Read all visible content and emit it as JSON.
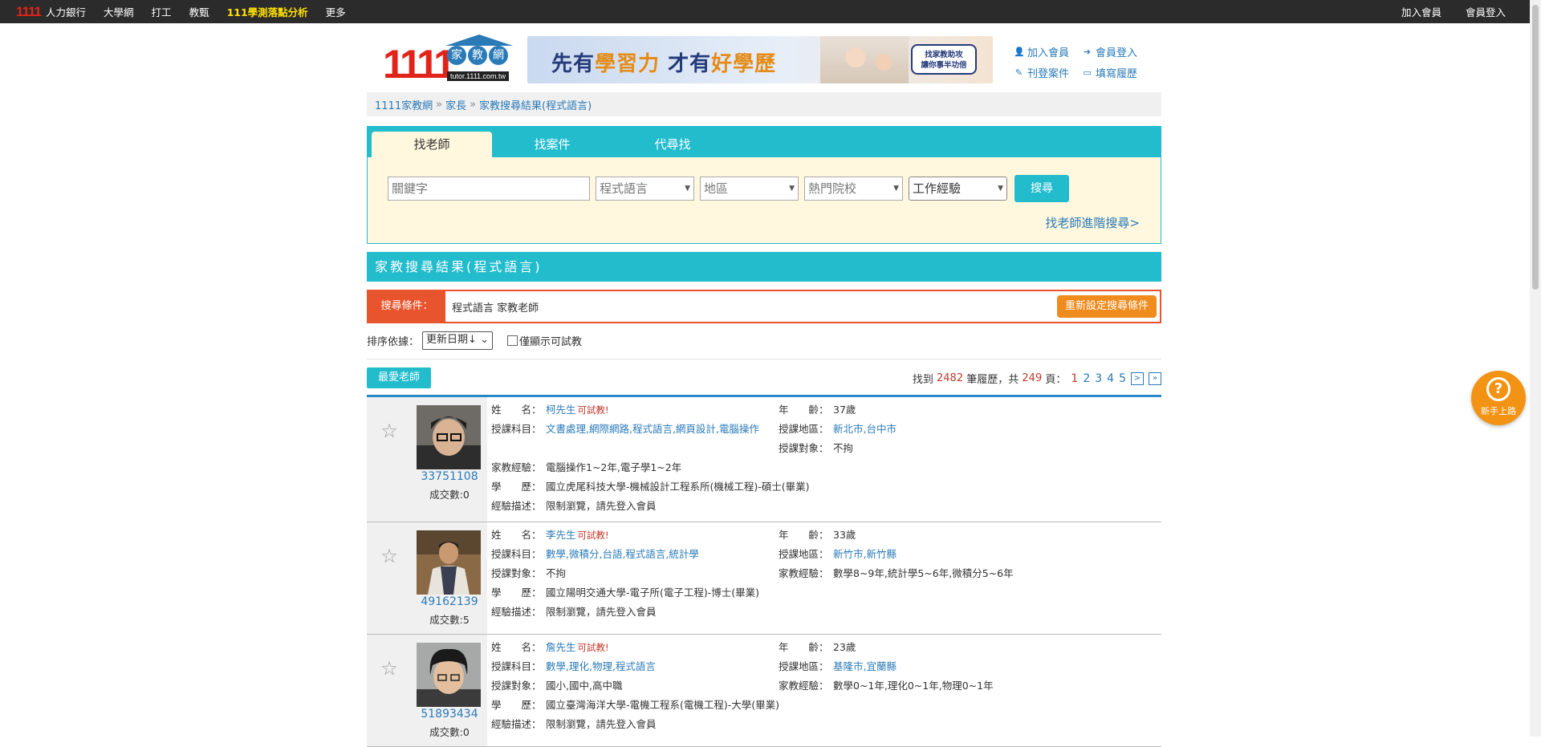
{
  "topbar": {
    "brand_num": "1111",
    "brand_label": "人力銀行",
    "links": [
      "大學網",
      "打工",
      "教甄"
    ],
    "highlight": "111學測落點分析",
    "more": "更多",
    "right": [
      "加入會員",
      "會員登入"
    ]
  },
  "header": {
    "logo_num": "1111",
    "logo_chars": [
      "家",
      "教",
      "網"
    ],
    "logo_url": "tutor.1111.com.tw",
    "banner_slogan_a": "先有",
    "banner_slogan_b": "學習力",
    "banner_slogan_c": "才有",
    "banner_slogan_d": "好學歷",
    "banner_badge_1": "找家教助攻",
    "banner_badge_2": "讓你事半功倍",
    "links": {
      "join": "加入會員",
      "login": "會員登入",
      "post_case": "刊登案件",
      "resume": "填寫履歷"
    }
  },
  "breadcrumb": [
    "1111家教網",
    "家長",
    "家教搜尋結果(程式語言)"
  ],
  "search": {
    "tabs": [
      "找老師",
      "找案件",
      "代尋找"
    ],
    "keyword_placeholder": "關鍵字",
    "subject": "程式語言",
    "area": "地區",
    "school": "熱門院校",
    "experience": "工作經驗",
    "button": "搜尋",
    "advanced": "找老師進階搜尋>"
  },
  "results": {
    "title": "家教搜尋結果(程式語言)",
    "condition_label": "搜尋條件：",
    "condition_value": "程式語言 家教老師",
    "reset": "重新設定搜尋條件",
    "sort_label": "排序依據：",
    "sort_value": "更新日期↓",
    "trial_only": "僅顯示可試教",
    "fav": "最愛老師",
    "found_pre": "找到",
    "found_count": "2482",
    "found_mid": "筆履歷，共",
    "pages_total": "249",
    "found_post": "頁：",
    "pages": [
      "1",
      "2",
      "3",
      "4",
      "5"
    ],
    "next": ">",
    "last": "»"
  },
  "teachers": [
    {
      "id": "33751108",
      "deals": "成交數:0",
      "name": "柯先生",
      "trial": "可試教!",
      "age": "37歲",
      "subjects": "文書處理,網際網路,程式語言,網頁設計,電腦操作",
      "area": "新北市,台中市",
      "target": "不拘",
      "experience": "電腦操作1~2年,電子學1~2年",
      "education": "國立虎尾科技大學-機械設計工程系所(機械工程)-碩士(畢業)",
      "description": "限制瀏覽，請先登入會員"
    },
    {
      "id": "49162139",
      "deals": "成交數:5",
      "name": "李先生",
      "trial": "可試教!",
      "age": "33歲",
      "subjects": "數學,微積分,台語,程式語言,統計學",
      "area": "新竹市,新竹縣",
      "target": "不拘",
      "experience": "數學8~9年,統計學5~6年,微積分5~6年",
      "education": "國立陽明交通大學-電子所(電子工程)-博士(畢業)",
      "description": "限制瀏覽，請先登入會員"
    },
    {
      "id": "51893434",
      "deals": "成交數:0",
      "name": "詹先生",
      "trial": "可試教!",
      "age": "23歲",
      "subjects": "數學,理化,物理,程式語言",
      "area": "基隆市,宜蘭縣",
      "target": "國小,國中,高中職",
      "experience": "數學0~1年,理化0~1年,物理0~1年",
      "education": "國立臺灣海洋大學-電機工程系(電機工程)-大學(畢業)",
      "description": "限制瀏覽，請先登入會員"
    }
  ],
  "labels": {
    "name": "姓　　名：",
    "age": "年　　齡：",
    "subjects": "授課科目：",
    "area": "授課地區：",
    "target": "授課對象：",
    "experience": "家教經驗：",
    "education": "學　　歷：",
    "description": "經驗描述："
  },
  "help": "新手上路"
}
